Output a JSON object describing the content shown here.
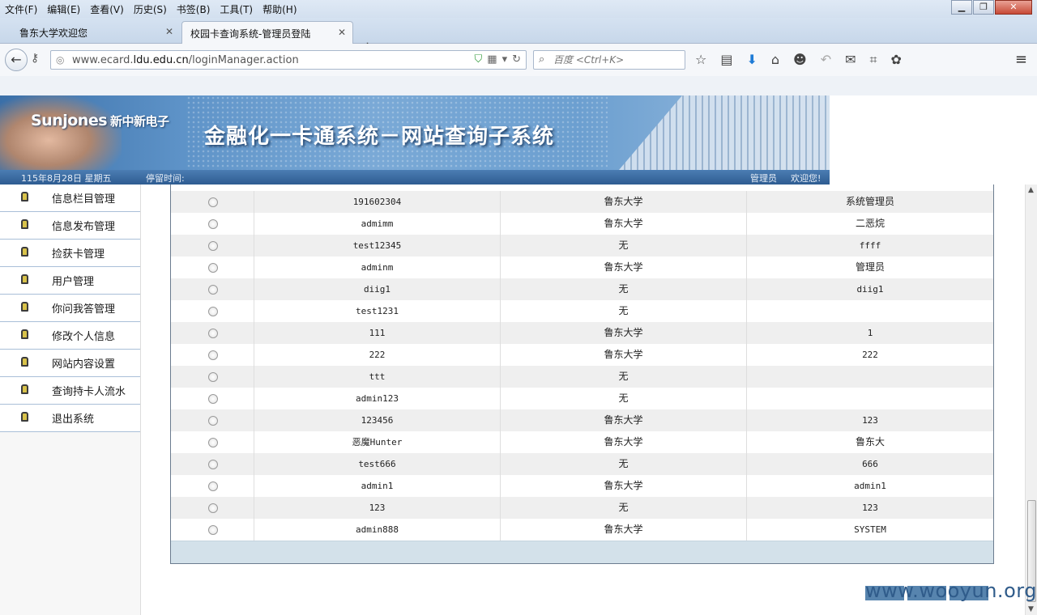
{
  "menu": [
    "文件(F)",
    "编辑(E)",
    "查看(V)",
    "历史(S)",
    "书签(B)",
    "工具(T)",
    "帮助(H)"
  ],
  "tabs": [
    {
      "label": "鲁东大学欢迎您"
    },
    {
      "label": "校园卡查询系统-管理员登陆"
    }
  ],
  "address": {
    "host": "www.ecard.",
    "domain": "ldu.edu.cn",
    "path": "/loginManager.action"
  },
  "search": {
    "placeholder": "百度 <Ctrl+K>"
  },
  "banner": {
    "brand": "Sunjones",
    "brand_cn": "新中新电子",
    "title": "金融化一卡通系统－网站查询子系统"
  },
  "infobar": {
    "date": "115年8月28日 星期五",
    "stay": "停留时间:",
    "role": "管理员",
    "welcome": "欢迎您!"
  },
  "sidebar": [
    "信息栏目管理",
    "信息发布管理",
    "捡获卡管理",
    "用户管理",
    "你问我答管理",
    "修改个人信息",
    "网站内容设置",
    "查询持卡人流水",
    "退出系统"
  ],
  "rows": [
    {
      "id": "191602304",
      "org": "鲁东大学",
      "name": "系统管理员"
    },
    {
      "id": "admimm",
      "org": "鲁东大学",
      "name": "二恶烷"
    },
    {
      "id": "test12345",
      "org": "无",
      "name": "ffff"
    },
    {
      "id": "adminm",
      "org": "鲁东大学",
      "name": "管理员"
    },
    {
      "id": "diig1",
      "org": "无",
      "name": "diig1"
    },
    {
      "id": "test1231",
      "org": "无",
      "name": ""
    },
    {
      "id": "111",
      "org": "鲁东大学",
      "name": "1"
    },
    {
      "id": "222",
      "org": "鲁东大学",
      "name": "222"
    },
    {
      "id": "ttt",
      "org": "无",
      "name": ""
    },
    {
      "id": "admin123",
      "org": "无",
      "name": ""
    },
    {
      "id": "123456",
      "org": "鲁东大学",
      "name": "123"
    },
    {
      "id": "恶魔Hunter",
      "org": "鲁东大学",
      "name": "鲁东大"
    },
    {
      "id": "test666",
      "org": "无",
      "name": "666"
    },
    {
      "id": "admin1",
      "org": "鲁东大学",
      "name": "admin1"
    },
    {
      "id": "123",
      "org": "无",
      "name": "123"
    },
    {
      "id": "admin888",
      "org": "鲁东大学",
      "name": "SYSTEM"
    }
  ],
  "watermark": "www.wooyun.org"
}
